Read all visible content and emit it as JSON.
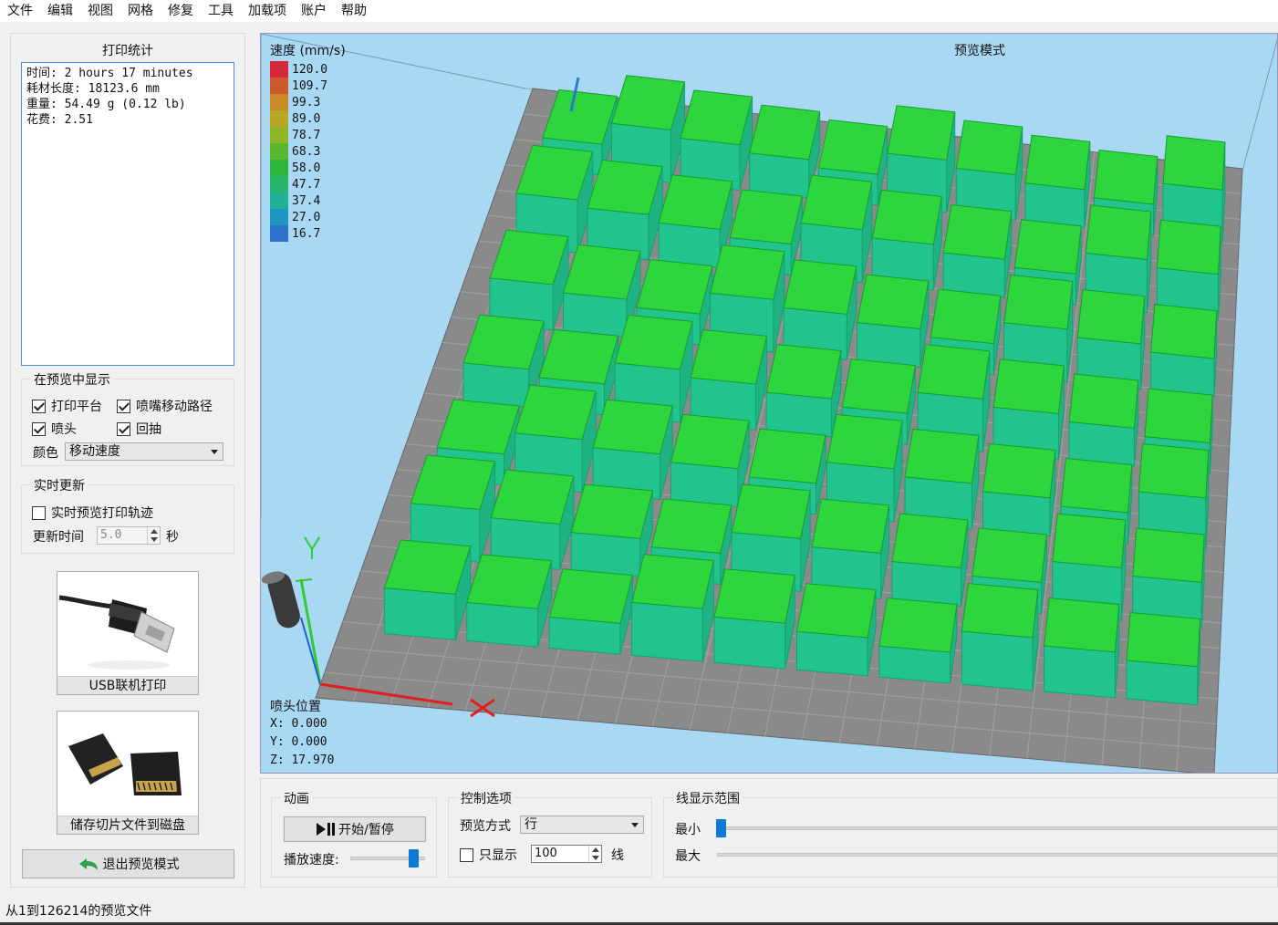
{
  "menu": [
    "文件",
    "编辑",
    "视图",
    "网格",
    "修复",
    "工具",
    "加载项",
    "账户",
    "帮助"
  ],
  "stats": {
    "title": "打印统计",
    "lines": [
      "时间: 2 hours 17 minutes",
      "耗材长度: 18123.6 mm",
      "重量: 54.49 g (0.12 lb)",
      "花费: 2.51"
    ]
  },
  "preview_show": {
    "title": "在预览中显示",
    "platform": "打印平台",
    "travel": "喷嘴移动路径",
    "nozzle": "喷头",
    "retract": "回抽",
    "color_label": "颜色",
    "color_value": "移动速度"
  },
  "realtime": {
    "title": "实时更新",
    "realtime_preview": "实时预览打印轨迹",
    "update_label": "更新时间",
    "update_value": "5.0",
    "unit": "秒"
  },
  "buttons": {
    "usb": "USB联机打印",
    "save": "储存切片文件到磁盘",
    "exit": "退出预览模式"
  },
  "viewport": {
    "speed_label": "速度 (mm/s)",
    "mode_label": "预览模式",
    "legend": [
      {
        "value": "120.0",
        "color": "#d6283a"
      },
      {
        "value": "109.7",
        "color": "#cc5a2c"
      },
      {
        "value": "99.3",
        "color": "#c98a28"
      },
      {
        "value": "89.0",
        "color": "#b9a726"
      },
      {
        "value": "78.7",
        "color": "#8fb528"
      },
      {
        "value": "68.3",
        "color": "#5ab82e"
      },
      {
        "value": "58.0",
        "color": "#2eb63c"
      },
      {
        "value": "47.7",
        "color": "#28b46a"
      },
      {
        "value": "37.4",
        "color": "#22b09a"
      },
      {
        "value": "27.0",
        "color": "#1e98c2"
      },
      {
        "value": "16.7",
        "color": "#2a72cc"
      }
    ],
    "position_title": "喷头位置",
    "x": "X: 0.000",
    "y": "Y: 0.000",
    "z": "Z: 17.970"
  },
  "animation": {
    "title": "动画",
    "play_pause": "开始/暂停",
    "speed_label": "播放速度:"
  },
  "control": {
    "title": "控制选项",
    "mode_label": "预览方式",
    "mode_value": "行",
    "only_show": "只显示",
    "count": "100",
    "unit": "线"
  },
  "range": {
    "title": "线显示范围",
    "min": "最小",
    "max": "最大"
  },
  "status": "从1到126214的预览文件"
}
